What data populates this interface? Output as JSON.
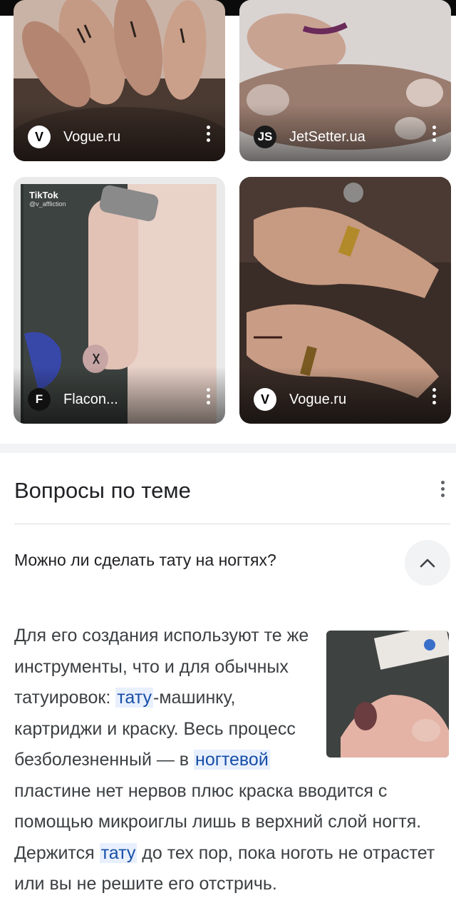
{
  "images": [
    {
      "source": "Vogue.ru",
      "logo": "V"
    },
    {
      "source": "JetSetter.ua",
      "logo": "JS"
    },
    {
      "source": "Flacon...",
      "logo": "F",
      "watermark": "TikTok",
      "watermark_handle": "@v_affliction"
    },
    {
      "source": "Vogue.ru",
      "logo": "V"
    }
  ],
  "paa": {
    "title": "Вопросы по теме",
    "question": "Можно ли сделать тату на ногтях?",
    "answer": {
      "p1": "Для его создания используют те же инструменты, что и для обычных татуировок: ",
      "h1": "тату",
      "p2": "-машинку, картриджи и краску. Весь процесс безболезненный — в ",
      "h2": "ногтевой",
      "p3": " пластине нет нервов плюс краска вводится с помощью микроиглы лишь в верхний слой ногтя. Держится ",
      "h3": "тату",
      "p4": " до тех пор, пока ноготь не отрастет или вы не решите его отстричь."
    }
  },
  "icons": {
    "more": "more-vert-icon",
    "collapse": "chevron-up-icon"
  }
}
